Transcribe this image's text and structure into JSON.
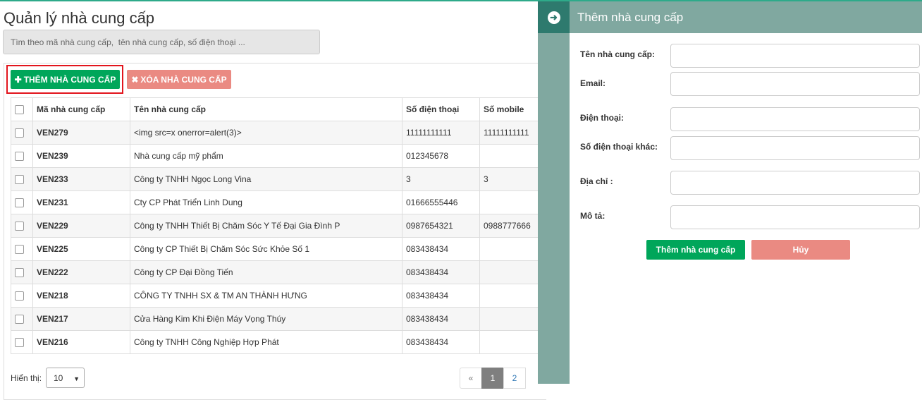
{
  "page": {
    "title": "Quản lý nhà cung cấp",
    "search_placeholder": "Tìm theo mã nhà cung cấp,  tên nhà cung cấp, số điện thoại ..."
  },
  "toolbar": {
    "add_label": "THÊM NHÀ CUNG CẤP",
    "add_icon": "plus-icon",
    "delete_label": "XÓA NHÀ CUNG CẤP",
    "delete_icon": "times-icon"
  },
  "table": {
    "columns": [
      "Mã nhà cung cấp",
      "Tên nhà cung cấp",
      "Số điện thoại",
      "Số mobile"
    ],
    "rows": [
      {
        "code": "VEN279",
        "name": "<img src=x onerror=alert(3)>",
        "phone": "11111111111",
        "mobile": "11111111111"
      },
      {
        "code": "VEN239",
        "name": "Nhà cung cấp mỹ phẩm",
        "phone": "012345678",
        "mobile": ""
      },
      {
        "code": "VEN233",
        "name": "Công ty TNHH Ngọc Long Vina",
        "phone": "3",
        "mobile": "3"
      },
      {
        "code": "VEN231",
        "name": "Cty CP Phát Triển Linh Dung",
        "phone": "01666555446",
        "mobile": ""
      },
      {
        "code": "VEN229",
        "name": "Công ty TNHH Thiết Bị Chăm Sóc Y Tế Đại Gia Đình P",
        "phone": "0987654321",
        "mobile": "0988777666"
      },
      {
        "code": "VEN225",
        "name": "Công ty CP Thiết Bị Chăm Sóc Sức Khỏe Số 1",
        "phone": "083438434",
        "mobile": ""
      },
      {
        "code": "VEN222",
        "name": "Công ty CP Đại Đồng Tiến",
        "phone": "083438434",
        "mobile": ""
      },
      {
        "code": "VEN218",
        "name": "CÔNG TY TNHH SX & TM AN THÀNH HƯNG",
        "phone": "083438434",
        "mobile": ""
      },
      {
        "code": "VEN217",
        "name": "Cửa Hàng Kim Khi Điện Máy Vọng Thúy",
        "phone": "083438434",
        "mobile": ""
      },
      {
        "code": "VEN216",
        "name": "Công ty TNHH Công Nghiệp Hợp Phát",
        "phone": "083438434",
        "mobile": ""
      }
    ]
  },
  "pagination": {
    "show_label": "Hiển thị:",
    "page_size": "10",
    "prev": "«",
    "pages": [
      "1",
      "2"
    ],
    "current": "1"
  },
  "side_panel": {
    "title": "Thêm nhà cung cấp",
    "toggle_icon": "arrow-circle-right-icon",
    "fields": [
      {
        "label": "Tên nhà cung cấp:",
        "value": ""
      },
      {
        "label": "Email:",
        "value": ""
      },
      {
        "label": "Điện thoại:",
        "value": ""
      },
      {
        "label": "Số điện thoại khác:",
        "value": ""
      },
      {
        "label": "Địa chỉ :",
        "value": ""
      },
      {
        "label": "Mô tả:",
        "value": ""
      }
    ],
    "submit_label": "Thêm nhà cung cấp",
    "cancel_label": "Hủy"
  },
  "colors": {
    "accent_green": "#00a65a",
    "danger_light": "#ea8a82",
    "panel_header": "#80a8a0",
    "highlight_border": "#e2151d"
  }
}
